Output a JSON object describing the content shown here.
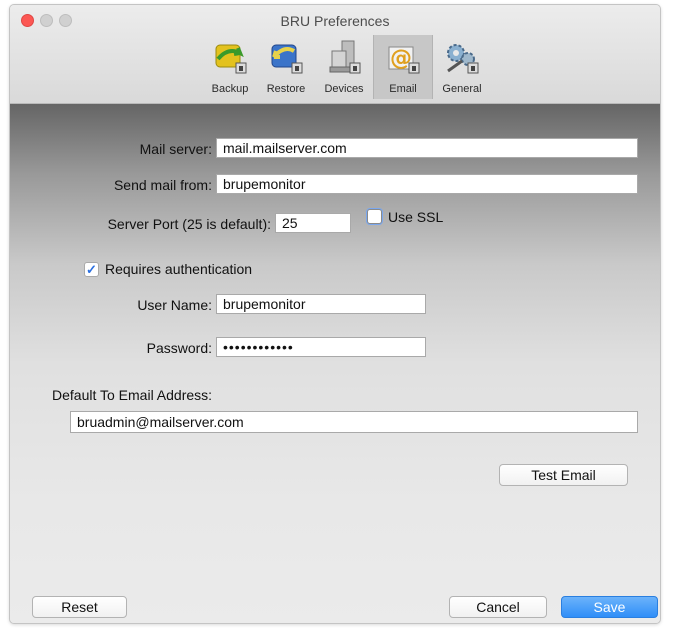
{
  "window": {
    "title": "BRU Preferences"
  },
  "toolbar": {
    "tabs": [
      {
        "label": "Backup",
        "icon": "backup-icon"
      },
      {
        "label": "Restore",
        "icon": "restore-icon"
      },
      {
        "label": "Devices",
        "icon": "devices-icon"
      },
      {
        "label": "Email",
        "icon": "email-icon",
        "active": true
      },
      {
        "label": "General",
        "icon": "general-gears-icon"
      }
    ]
  },
  "email": {
    "mail_server_label": "Mail server:",
    "mail_server_value": "mail.mailserver.com",
    "send_from_label": "Send mail from:",
    "send_from_value": "brupemonitor",
    "port_label": "Server Port (25 is default):",
    "port_value": "25",
    "ssl_label": "Use SSL",
    "auth_label": "Requires authentication",
    "auth_mark": "✓",
    "username_label": "User Name:",
    "username_value": "brupemonitor",
    "password_label": "Password:",
    "password_value": "••••••••••••",
    "default_to_label": "Default To Email Address:",
    "default_to_value": "bruadmin@mailserver.com",
    "test_button": "Test Email"
  },
  "footer": {
    "reset": "Reset",
    "cancel": "Cancel",
    "save": "Save"
  },
  "colors": {
    "accent": "#2f8ef8",
    "close_light": "#fc5753"
  }
}
